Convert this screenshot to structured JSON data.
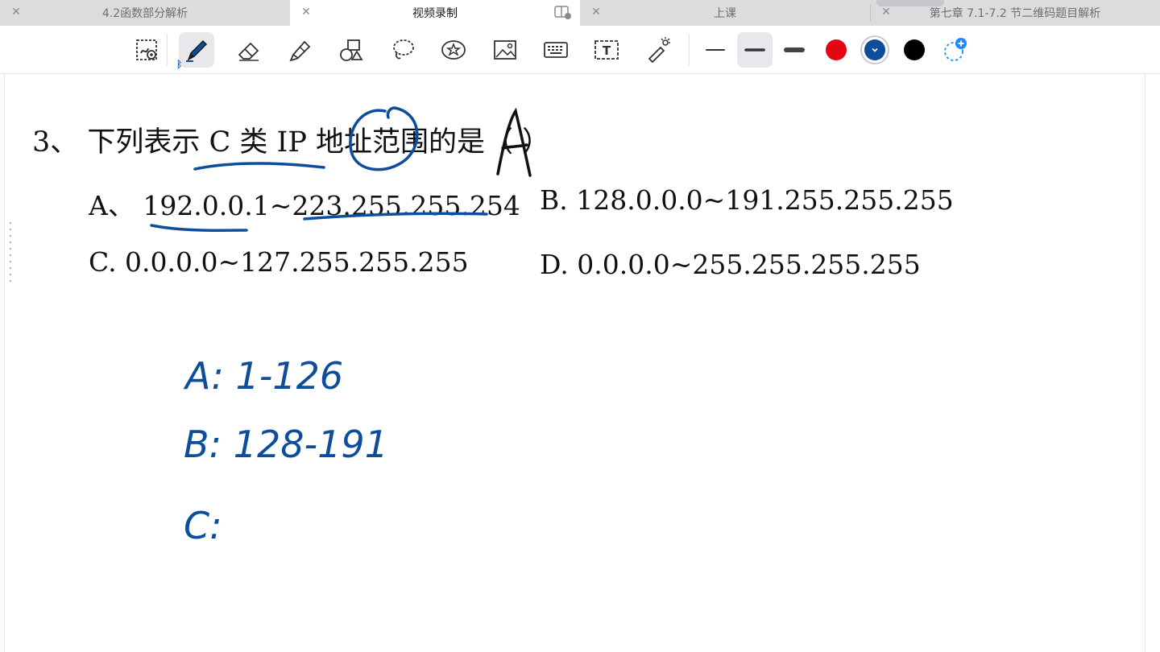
{
  "tabs": [
    {
      "label": "4.2函数部分解析",
      "active": false
    },
    {
      "label": "视频录制",
      "active": true
    },
    {
      "label": "上课",
      "active": false
    },
    {
      "label": "第七章 7.1-7.2 节二维码题目解析",
      "active": false
    }
  ],
  "toolbar": {
    "tools": [
      "zoom-select-icon",
      "pen-icon",
      "eraser-icon",
      "highlighter-icon",
      "shapes-icon",
      "lasso-icon",
      "sticker-icon",
      "image-icon",
      "keyboard-icon",
      "text-box-icon",
      "laser-pointer-icon"
    ],
    "selected_tool": "pen-icon",
    "stroke_widths": [
      "thin",
      "medium",
      "thick"
    ],
    "selected_width": "medium",
    "colors": [
      "#e30613",
      "#0d4d9c",
      "#000000"
    ],
    "selected_color": "#0d4d9c"
  },
  "question": {
    "title": "3、 下列表示 C 类 IP 地址范围的是（    ）",
    "handwritten_answer": "A",
    "options": {
      "a": "A、 192.0.0.1~223.255.255.254",
      "b": "B. 128.0.0.0~191.255.255.255",
      "c": "C.    0.0.0.0~127.255.255.255",
      "d": "D. 0.0.0.0~255.255.255.255"
    }
  },
  "notes": {
    "line_a": "A: 1-126",
    "line_b": "B: 128-191",
    "line_c": "C:"
  }
}
